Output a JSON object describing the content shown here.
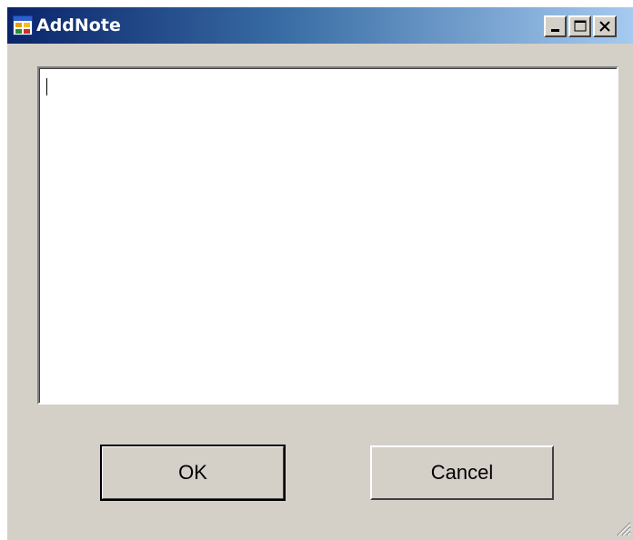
{
  "window": {
    "title": "AddNote",
    "icon": "app-form-icon",
    "controls": {
      "minimize_icon": "minimize-icon",
      "maximize_icon": "maximize-icon",
      "close_icon": "close-icon"
    }
  },
  "note_input": {
    "value": ""
  },
  "buttons": {
    "ok_label": "OK",
    "cancel_label": "Cancel"
  },
  "colors": {
    "face": "#d4d0c8",
    "title_start": "#0a246a",
    "title_end": "#a6caf0"
  }
}
